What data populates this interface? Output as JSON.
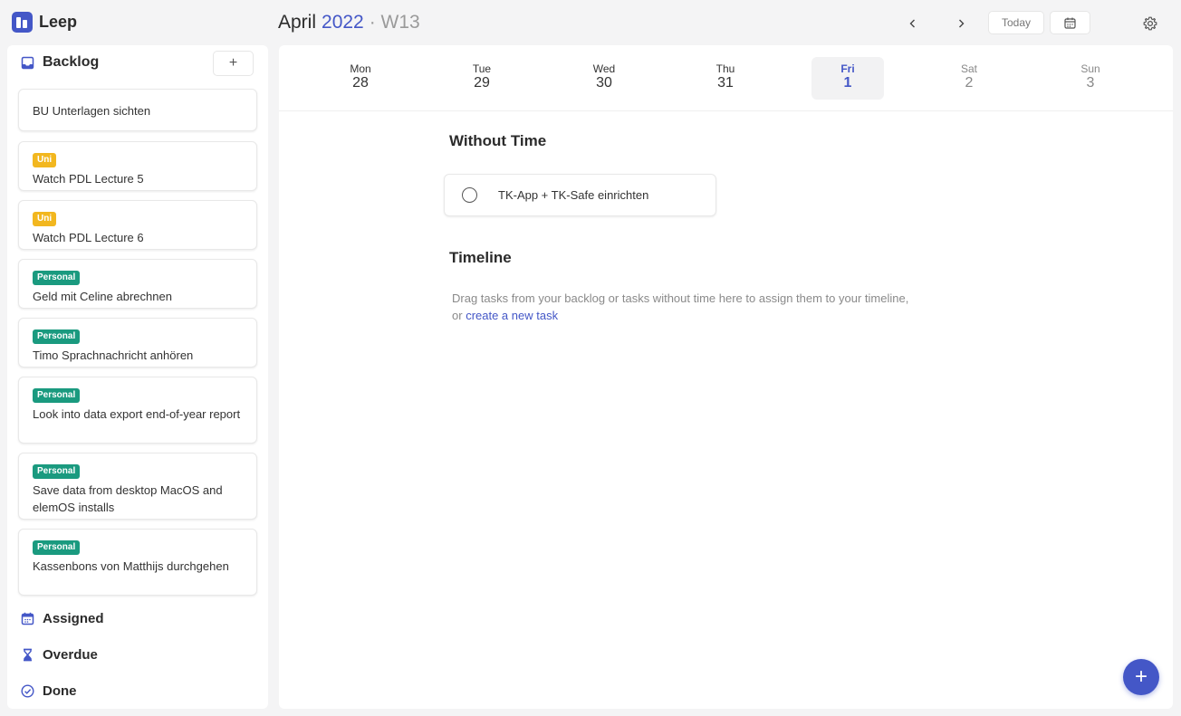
{
  "app": {
    "name": "Leep"
  },
  "header": {
    "month": "April",
    "year": "2022",
    "week": "· W13",
    "today_label": "Today"
  },
  "sidebar": {
    "backlog_title": "Backlog",
    "add_label": "+",
    "cards": [
      {
        "tag": "",
        "title": "BU Unterlagen sichten"
      },
      {
        "tag": "Uni",
        "title": "Watch PDL Lecture 5"
      },
      {
        "tag": "Uni",
        "title": "Watch PDL Lecture 6"
      },
      {
        "tag": "Personal",
        "title": "Geld mit Celine abrechnen"
      },
      {
        "tag": "Personal",
        "title": "Timo Sprachnachricht anhören"
      },
      {
        "tag": "Personal",
        "title": "Look into data export end-of-year report"
      },
      {
        "tag": "Personal",
        "title": "Save data from desktop MacOS and elemOS installs"
      },
      {
        "tag": "Personal",
        "title": "Kassenbons von Matthijs durchgehen"
      }
    ],
    "links": {
      "assigned": "Assigned",
      "overdue": "Overdue",
      "done": "Done"
    }
  },
  "days": [
    {
      "name": "Mon",
      "num": "28"
    },
    {
      "name": "Tue",
      "num": "29"
    },
    {
      "name": "Wed",
      "num": "30"
    },
    {
      "name": "Thu",
      "num": "31"
    },
    {
      "name": "Fri",
      "num": "1"
    },
    {
      "name": "Sat",
      "num": "2"
    },
    {
      "name": "Sun",
      "num": "3"
    }
  ],
  "main": {
    "without_time_title": "Without Time",
    "task": "TK-App + TK-Safe einrichten",
    "timeline_title": "Timeline",
    "hint_line1": "Drag tasks from your backlog or tasks without time here to assign them to your timeline,",
    "hint_or": "or",
    "hint_link": "create a new task"
  },
  "fab_label": "+",
  "colors": {
    "accent": "#4457c7",
    "uni": "#f2b71f",
    "personal": "#1a9a7f"
  },
  "icons": [
    "logo-icon",
    "chevron-left-icon",
    "chevron-right-icon",
    "calendar-icon",
    "gear-icon",
    "inbox-icon",
    "hourglass-icon",
    "check-circle-icon",
    "plus-icon"
  ]
}
